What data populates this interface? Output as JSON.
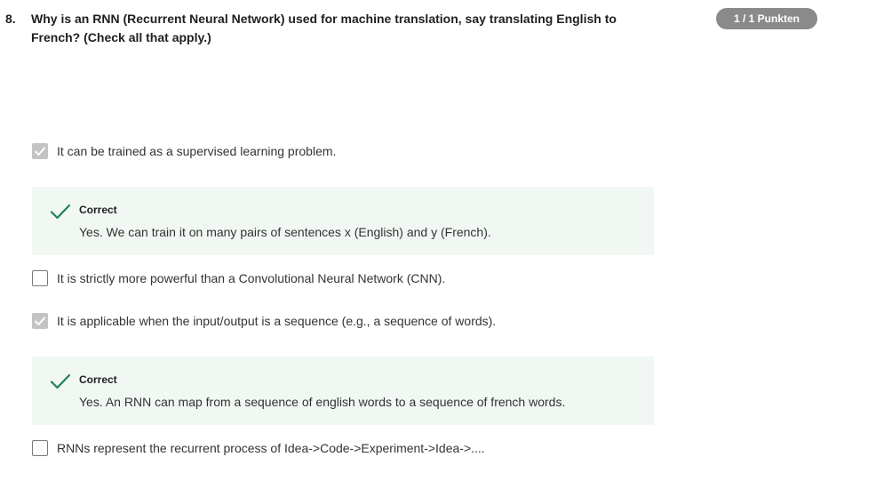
{
  "question": {
    "number": "8.",
    "text": "Why is an RNN (Recurrent Neural Network) used for machine translation, say translating English to French? (Check all that apply.)"
  },
  "score_badge": "1 / 1 Punkten",
  "options": [
    {
      "label": "It can be trained as a supervised learning problem.",
      "checked": true
    },
    {
      "label": "It is strictly more powerful than a Convolutional Neural Network (CNN).",
      "checked": false
    },
    {
      "label": "It is applicable when the input/output is a sequence (e.g., a sequence of words).",
      "checked": true
    },
    {
      "label": "RNNs represent the recurrent process of Idea->Code->Experiment->Idea->....",
      "checked": false
    }
  ],
  "feedback": [
    {
      "title": "Correct",
      "text": "Yes. We can train it on many pairs of sentences x (English) and y (French).",
      "icon": "checkmark-icon"
    },
    {
      "title": "Correct",
      "text": "Yes. An RNN can map from a sequence of english words to a sequence of french words.",
      "icon": "checkmark-icon"
    }
  ],
  "colors": {
    "badge": "#8a8a8a",
    "feedback_bg": "#f1f8f3",
    "success": "#1f8354",
    "checked_box": "#c4c4c4"
  }
}
